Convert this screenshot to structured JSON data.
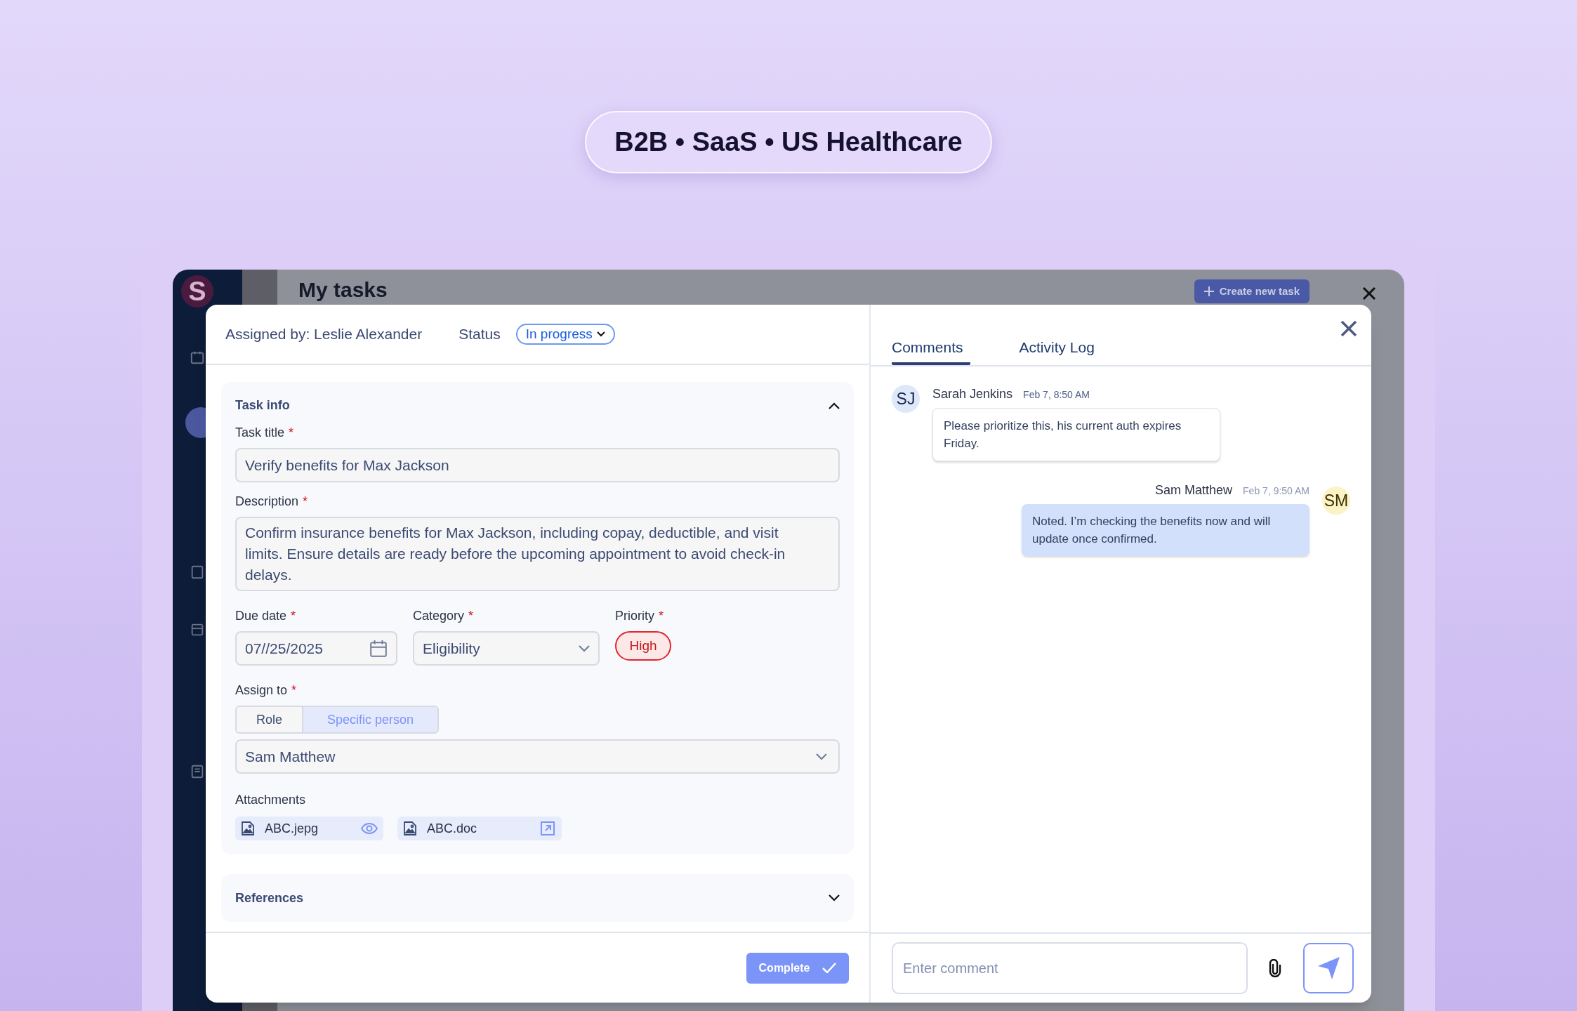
{
  "banner": {
    "text": "B2B • SaaS • US Healthcare"
  },
  "app": {
    "logo": "S",
    "page_title": "My tasks",
    "create_button": "Create new task"
  },
  "modal": {
    "assigned_by": "Assigned by: Leslie Alexander",
    "status_label": "Status",
    "status": "In progress",
    "required_mark": "*",
    "task_info": {
      "title": "Task info",
      "expanded": true,
      "task_title": {
        "label": "Task title",
        "required": true,
        "value": "Verify benefits for Max Jackson"
      },
      "description": {
        "label": "Description",
        "required": true,
        "value": "Confirm insurance benefits for Max Jackson, including copay, deductible, and visit limits. Ensure details are ready before the upcoming appointment to avoid check-in delays."
      },
      "due_date": {
        "label": "Due date",
        "required": true,
        "value": "07//25/2025"
      },
      "category": {
        "label": "Category",
        "required": true,
        "value": "Eligibility"
      },
      "priority": {
        "label": "Priority",
        "required": true,
        "value": "High"
      },
      "assign_to": {
        "label": "Assign to",
        "required": true,
        "options": [
          {
            "label": "Role",
            "selected": false
          },
          {
            "label": "Specific person",
            "selected": true
          }
        ],
        "value": "Sam Matthew"
      },
      "attachments": {
        "label": "Attachments",
        "items": [
          {
            "name": "ABC.jepg",
            "kind": "view"
          },
          {
            "name": "ABC.doc",
            "kind": "open"
          }
        ]
      }
    },
    "references": {
      "title": "References",
      "expanded": false
    },
    "complete_button": "Complete"
  },
  "comments_panel": {
    "tabs": [
      {
        "label": "Comments",
        "selected": true
      },
      {
        "label": "Activity Log",
        "selected": false
      }
    ],
    "comments": [
      {
        "initials": "SJ",
        "author": "Sarah Jenkins",
        "time": "Feb 7, 8:50 AM",
        "text": "Please prioritize this, his current auth expires Friday.",
        "own": false
      },
      {
        "initials": "SM",
        "author": "Sam Matthew",
        "time": "Feb 7, 9:50 AM",
        "text": "Noted. I’m checking the benefits now and will update once confirmed.",
        "own": true
      }
    ],
    "composer": {
      "placeholder": "Enter comment"
    }
  }
}
